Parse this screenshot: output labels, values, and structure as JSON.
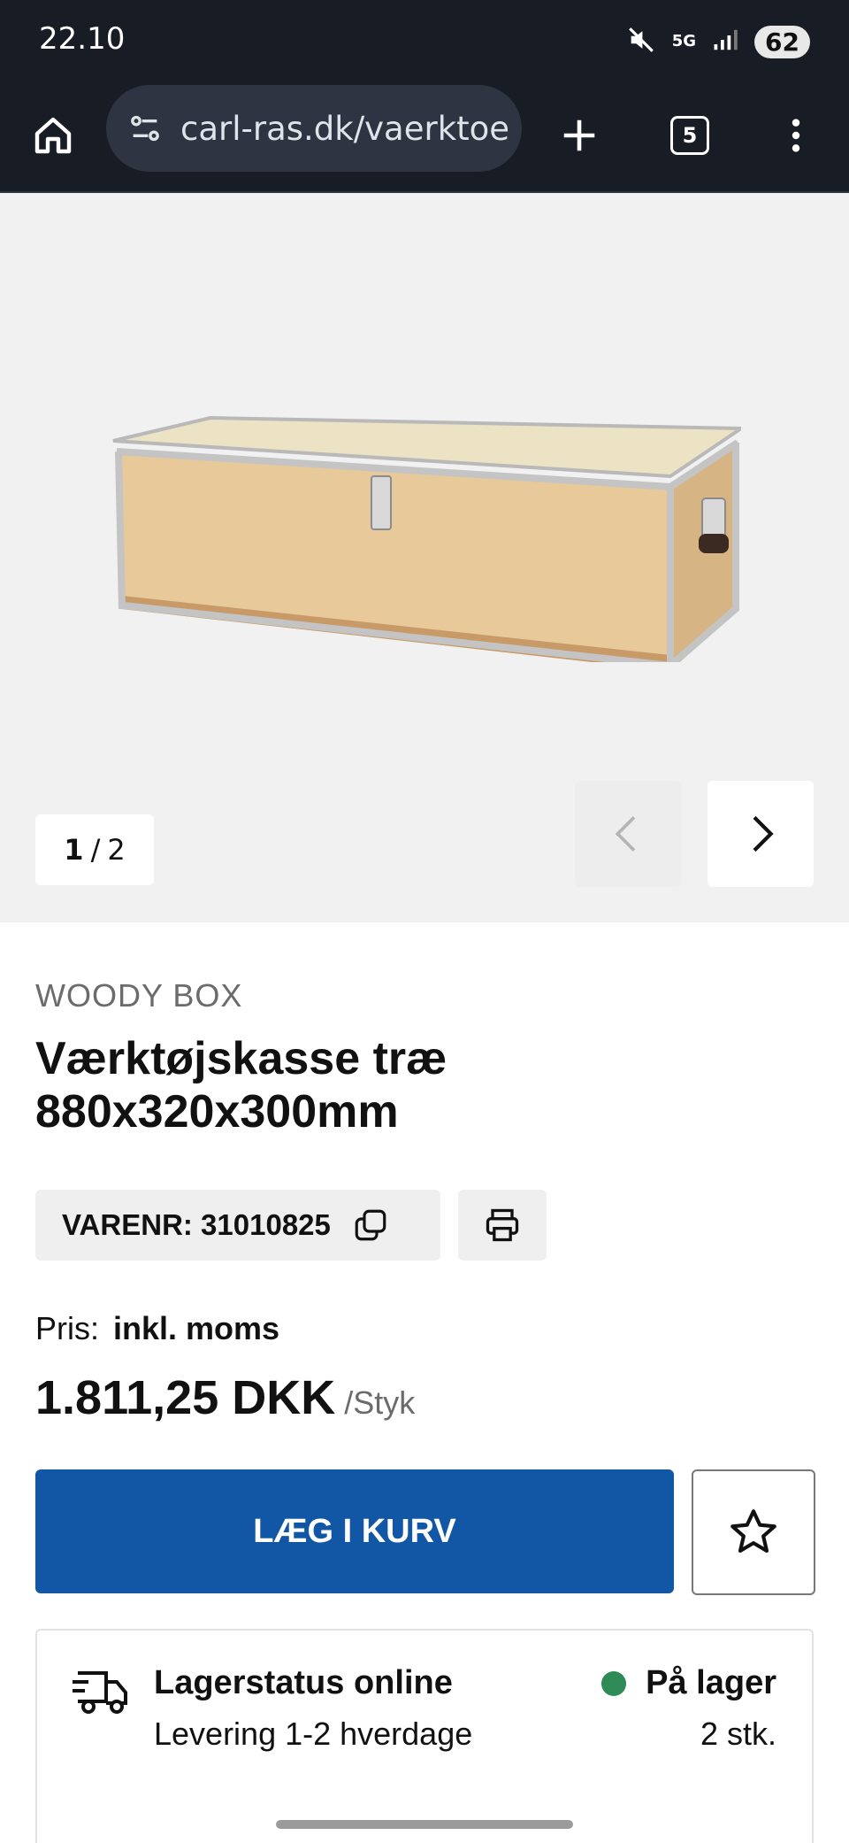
{
  "status_bar": {
    "time": "22.10",
    "network": "5G",
    "battery": "62"
  },
  "browser": {
    "url": "carl-ras.dk/vaerktoe",
    "tab_count": "5"
  },
  "gallery": {
    "current_index": "1",
    "separator": "/",
    "total": "2"
  },
  "product": {
    "brand": "WOODY BOX",
    "title": "Værktøjskasse træ 880x320x300mm",
    "sku_label": "VARENR: 31010825",
    "price_label": "Pris:",
    "vat_label": "inkl. moms",
    "price": "1.811,25 DKK",
    "unit": "/Styk"
  },
  "actions": {
    "add_to_cart": "LÆG I KURV"
  },
  "stock": {
    "title": "Lagerstatus online",
    "delivery": "Levering 1-2 hverdage",
    "status": "På lager",
    "quantity": "2 stk.",
    "status_color": "#2e8b57"
  },
  "colors": {
    "brand_blue": "#1157a5",
    "chrome_dark": "#181c24"
  }
}
